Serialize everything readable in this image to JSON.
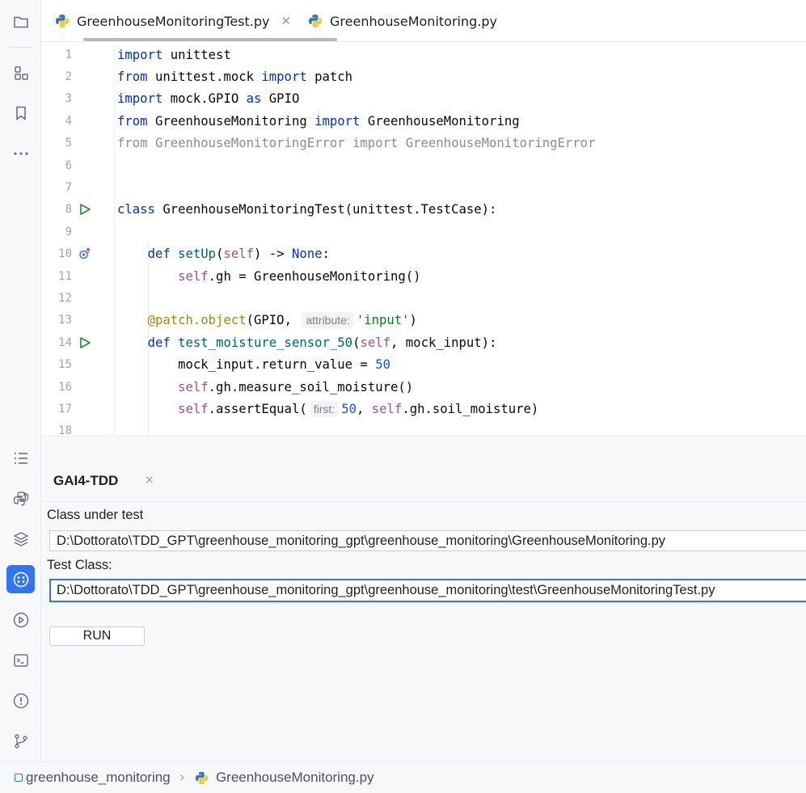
{
  "tabs": [
    {
      "label": "GreenhouseMonitoringTest.py",
      "active": true,
      "icon": "python-icon",
      "closable": true
    },
    {
      "label": "GreenhouseMonitoring.py",
      "active": false,
      "icon": "python-icon",
      "closable": false
    }
  ],
  "editor": {
    "line_numbers": [
      "1",
      "2",
      "3",
      "4",
      "5",
      "6",
      "7",
      "8",
      "9",
      "10",
      "11",
      "12",
      "13",
      "14",
      "15",
      "16",
      "17",
      "18"
    ],
    "code": {
      "l1": {
        "k1": "import",
        "t1": " unittest"
      },
      "l2": {
        "k1": "from",
        "t1": " unittest.mock ",
        "k2": "import",
        "t2": " patch"
      },
      "l3": {
        "k1": "import",
        "t1": " mock.GPIO ",
        "k2": "as",
        "t2": " GPIO"
      },
      "l4": {
        "k1": "from",
        "t1": " GreenhouseMonitoring ",
        "k2": "import",
        "t2": " GreenhouseMonitoring"
      },
      "l5": {
        "g1": "from GreenhouseMonitoringError import GreenhouseMonitoringError"
      },
      "l8": {
        "k1": "class",
        "t1": " GreenhouseMonitoringTest(unittest.TestCase):"
      },
      "l10": {
        "k1": "def",
        "f1": " setUp",
        "t1": "(",
        "s1": "self",
        "t2": ") -> ",
        "k2": "None",
        "t3": ":"
      },
      "l11": {
        "s1": "self",
        "t1": ".gh = GreenhouseMonitoring()"
      },
      "l13": {
        "d1": "@patch.object",
        "t1": "(GPIO, ",
        "hint": "attribute:",
        "str": "'input'",
        "t2": ")"
      },
      "l14": {
        "k1": "def",
        "f1": " test_moisture_sensor_50",
        "t1": "(",
        "s1": "self",
        "t2": ", mock_input):"
      },
      "l15": {
        "t1": "mock_input.return_value = ",
        "n1": "50"
      },
      "l16": {
        "s1": "self",
        "t1": ".gh.measure_soil_moisture()"
      },
      "l17": {
        "s1": "self",
        "t1": ".assertEqual(",
        "hint": "first:",
        "n1": "50",
        "t2": ", ",
        "s2": "self",
        "t3": ".gh.soil_moisture)"
      }
    },
    "gutter": {
      "l8": "run-test-icon",
      "l10": "override-method-icon",
      "l14": "run-test-icon"
    }
  },
  "tool_window": {
    "title": "GAI4-TDD",
    "close_symbol": "×",
    "class_under_test_label": "Class under test",
    "class_under_test_value": "D:\\Dottorato\\TDD_GPT\\greenhouse_monitoring_gpt\\greenhouse_monitoring\\GreenhouseMonitoring.py",
    "test_class_label": "Test Class:",
    "test_class_value": "D:\\Dottorato\\TDD_GPT\\greenhouse_monitoring_gpt\\greenhouse_monitoring\\test\\GreenhouseMonitoringTest.py",
    "run_label": "RUN"
  },
  "statusbar": {
    "project": "greenhouse_monitoring",
    "separator": "›",
    "file": "GreenhouseMonitoring.py"
  },
  "toolstrip": {
    "top": [
      "project-folder-icon",
      "structure-icon",
      "bookmark-icon",
      "more-icon"
    ],
    "bottom": [
      "todo-list-icon",
      "python-console-icon",
      "layers-icon",
      "gai4tdd-plugin-icon",
      "services-icon",
      "terminal-icon",
      "problems-icon",
      "git-icon"
    ],
    "active": "gai4tdd-plugin-icon"
  },
  "colors": {
    "accent": "#3574f0",
    "keyword": "#0033b3",
    "self": "#94558d",
    "number": "#1750eb",
    "string": "#067d17",
    "decorator": "#9e880d",
    "run_green": "#208a3c"
  }
}
